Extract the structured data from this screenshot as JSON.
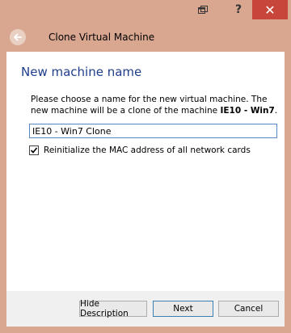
{
  "window": {
    "title": "Clone Virtual Machine",
    "help_label": "?",
    "close_label": "✕"
  },
  "page": {
    "heading": "New machine name",
    "description_prefix": "Please choose a name for the new virtual machine. The new machine will be a clone of the machine ",
    "description_machine": "IE10 - Win7",
    "description_suffix": "."
  },
  "form": {
    "name_value": "IE10 - Win7 Clone",
    "reinit_mac_label": "Reinitialize the MAC address of all network cards",
    "reinit_mac_checked": true
  },
  "buttons": {
    "hide_description": "Hide Description",
    "next": "Next",
    "cancel": "Cancel"
  }
}
